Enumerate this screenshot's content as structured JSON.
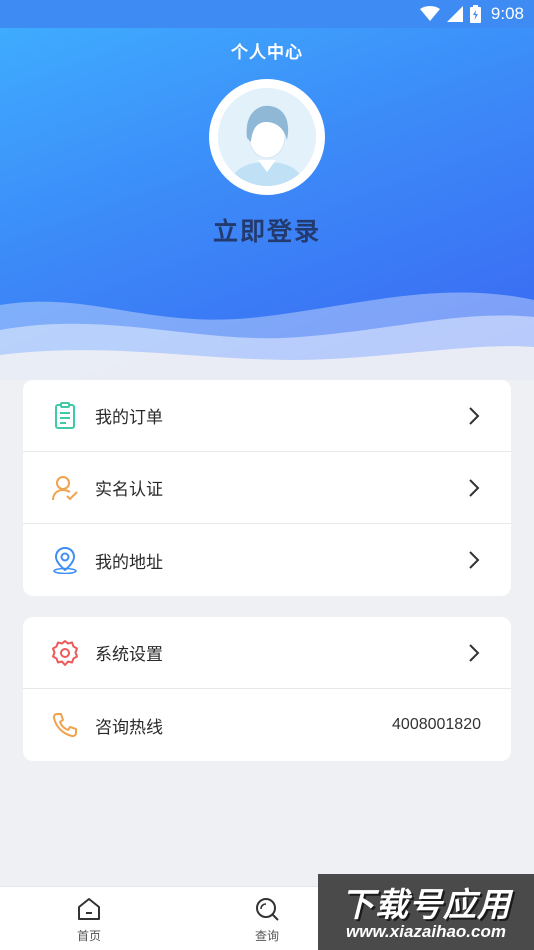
{
  "status_bar": {
    "time": "9:08",
    "icons": [
      "wifi-icon",
      "signal-icon",
      "battery-icon"
    ]
  },
  "header": {
    "title": "个人中心",
    "login_label": "立即登录"
  },
  "menu_group_1": [
    {
      "label": "我的订单",
      "icon": "order-clipboard-icon",
      "color": "#3ec9a7"
    },
    {
      "label": "实名认证",
      "icon": "user-verify-icon",
      "color": "#f0a24e"
    },
    {
      "label": "我的地址",
      "icon": "location-pin-icon",
      "color": "#3d8ff5"
    }
  ],
  "menu_group_2": [
    {
      "label": "系统设置",
      "icon": "gear-icon",
      "color": "#ee5a5a"
    },
    {
      "label": "咨询热线",
      "icon": "phone-icon",
      "color": "#f0a24e",
      "value": "4008001820"
    }
  ],
  "bottom_nav": [
    {
      "label": "首页",
      "icon": "home-icon"
    },
    {
      "label": "查询",
      "icon": "search-icon"
    }
  ],
  "watermark": {
    "main": "下载号应用",
    "sub": "www.xiazaihao.com"
  },
  "colors": {
    "header_gradient_start": "#3fb0ff",
    "header_gradient_end": "#3a66f2",
    "page_bg": "#eef0f4"
  }
}
